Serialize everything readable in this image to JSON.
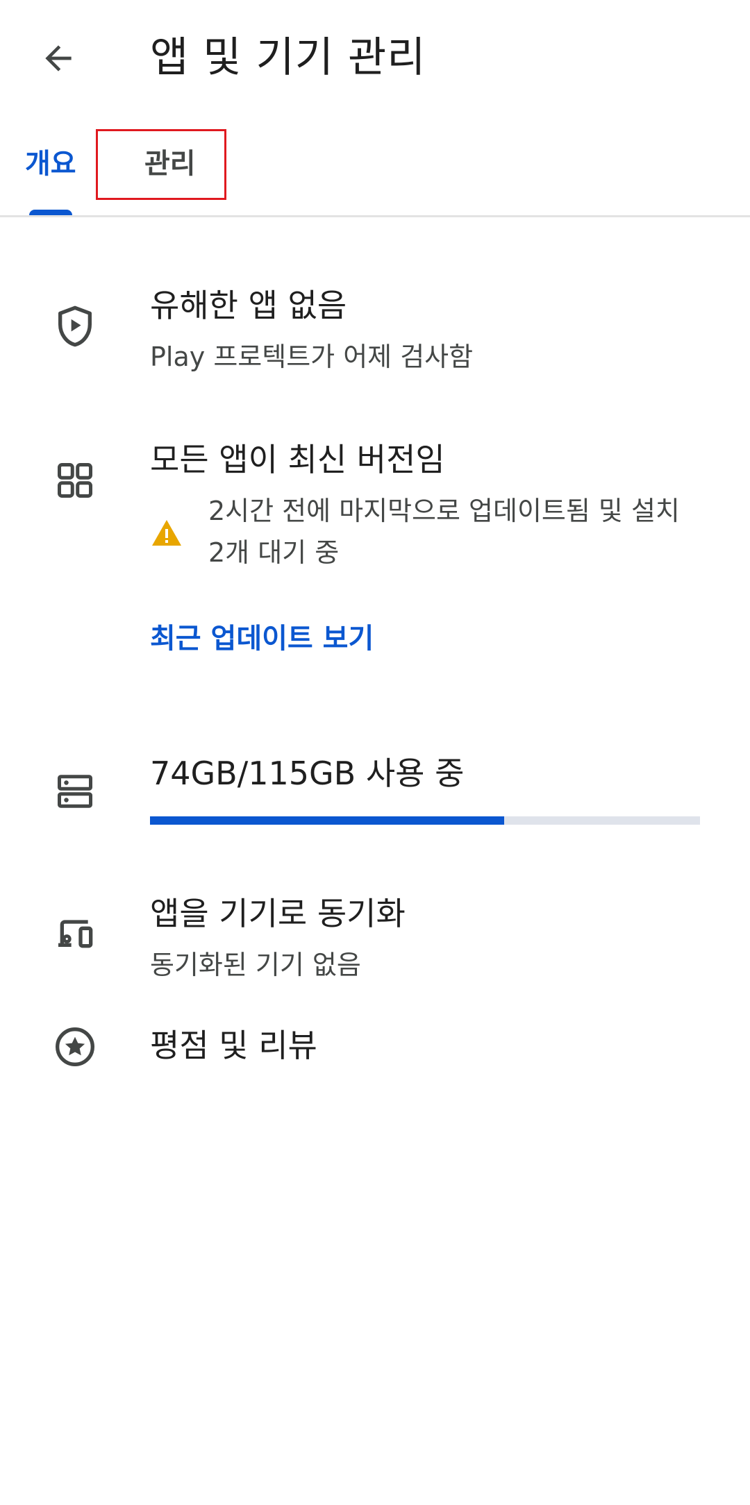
{
  "header": {
    "title": "앱 및 기기 관리",
    "back_icon": "arrow-back-icon"
  },
  "tabs": [
    {
      "label": "개요",
      "selected": true
    },
    {
      "label": "관리",
      "selected": false
    }
  ],
  "protect": {
    "title": "유해한 앱 없음",
    "subtitle": "Play 프로텍트가 어제 검사함",
    "icon": "shield-play-icon"
  },
  "updates": {
    "title": "모든 앱이 최신 버전임",
    "warning_line1": "2시간 전에 마지막으로 업데이트됨 및 설치",
    "warning_line2": "2개 대기 중",
    "link": "최근 업데이트 보기",
    "icon": "apps-grid-icon",
    "warning_icon": "warning-icon",
    "warning_color": "#e8a600"
  },
  "storage": {
    "label": "74GB/115GB 사용 중",
    "used_fraction": 0.6435,
    "icon": "storage-icon"
  },
  "sync": {
    "title": "앱을 기기로 동기화",
    "subtitle": "동기화된 기기 없음",
    "icon": "devices-icon"
  },
  "ratings": {
    "title": "평점 및 리뷰",
    "icon": "star-circle-icon"
  },
  "colors": {
    "accent": "#0b57d0",
    "highlight_box": "#e0191f",
    "progress_track": "#dfe3eb"
  }
}
